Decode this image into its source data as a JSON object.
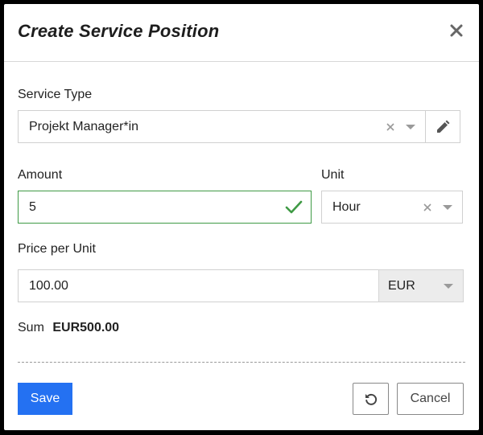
{
  "dialog": {
    "title": "Create Service Position"
  },
  "service_type": {
    "label": "Service Type",
    "value": "Projekt Manager*in"
  },
  "amount": {
    "label": "Amount",
    "value": "5"
  },
  "unit": {
    "label": "Unit",
    "value": "Hour"
  },
  "price": {
    "label": "Price per Unit",
    "value": "100.00",
    "currency": "EUR"
  },
  "sum": {
    "label": "Sum",
    "value": "EUR500.00"
  },
  "footer": {
    "save_label": "Save",
    "cancel_label": "Cancel"
  },
  "colors": {
    "primary": "#2471f2",
    "valid": "#3f9a45"
  }
}
